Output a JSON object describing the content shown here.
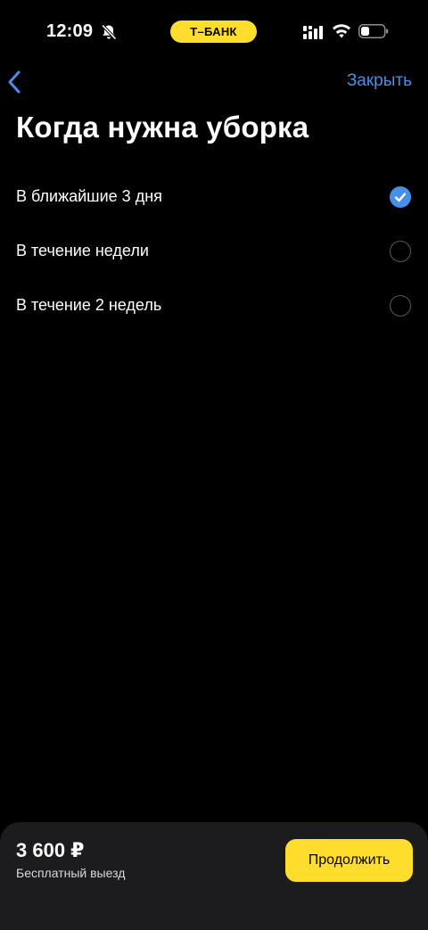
{
  "status_bar": {
    "time": "12:09",
    "carrier_pill": "Т–БАНК",
    "icons": [
      "bell-slash-icon",
      "cellular-signal-icon",
      "wifi-icon",
      "battery-icon"
    ]
  },
  "nav": {
    "back_icon": "chevron-left-icon",
    "close_label": "Закрыть"
  },
  "page": {
    "title": "Когда нужна уборка"
  },
  "options": [
    {
      "label": "В ближайшие 3 дня",
      "selected": true
    },
    {
      "label": "В течение недели",
      "selected": false
    },
    {
      "label": "В течение 2 недель",
      "selected": false
    }
  ],
  "footer": {
    "price": "3 600 ₽",
    "note": "Бесплатный выезд",
    "continue_label": "Продолжить"
  },
  "colors": {
    "accent_blue": "#4A8FE7",
    "brand_yellow": "#FFDD2D",
    "background": "#000000",
    "bottom_bar": "#1c1c1e"
  }
}
